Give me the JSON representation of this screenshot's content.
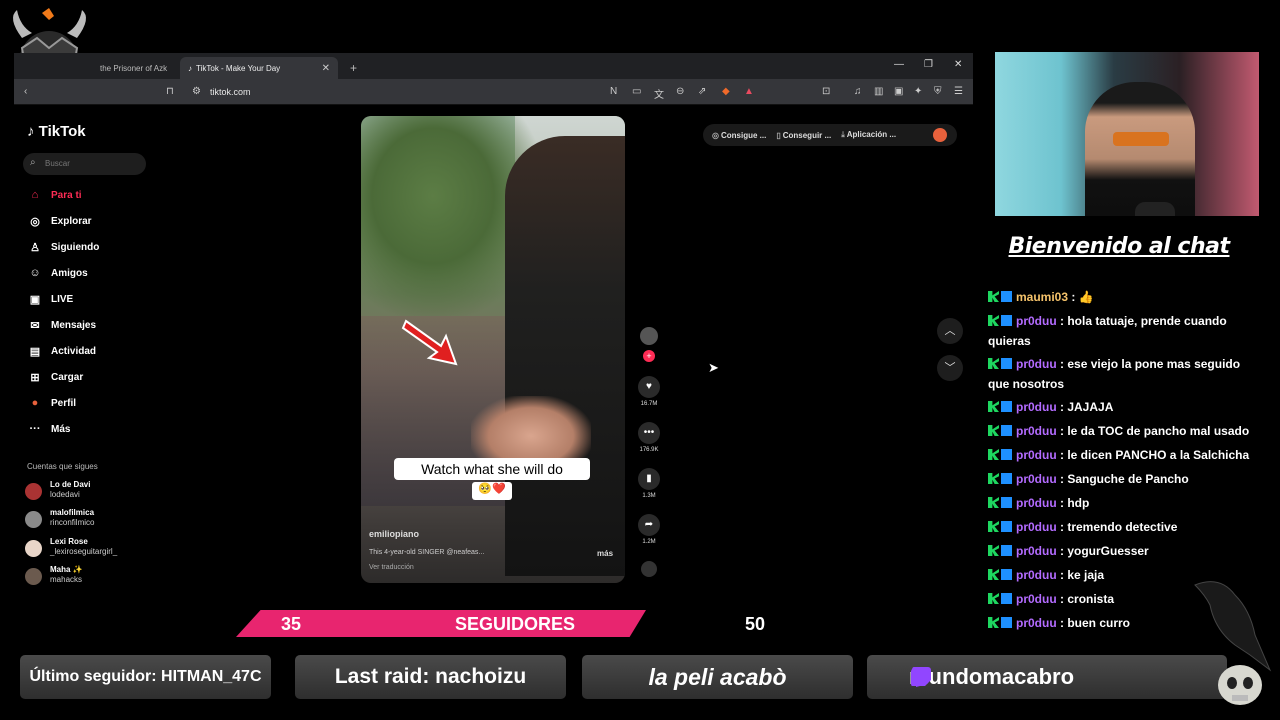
{
  "browser": {
    "tabs": [
      {
        "label": "the Prisoner of Azk"
      },
      {
        "label": "TikTok - Make Your Day"
      }
    ],
    "url": "tiktok.com"
  },
  "tiktok": {
    "logo": "TikTok",
    "search_placeholder": "Buscar",
    "nav": [
      {
        "label": "Para ti",
        "icon": "home-icon"
      },
      {
        "label": "Explorar",
        "icon": "compass-icon"
      },
      {
        "label": "Siguiendo",
        "icon": "following-icon"
      },
      {
        "label": "Amigos",
        "icon": "friends-icon"
      },
      {
        "label": "LIVE",
        "icon": "live-icon"
      },
      {
        "label": "Mensajes",
        "icon": "messages-icon"
      },
      {
        "label": "Actividad",
        "icon": "activity-icon"
      },
      {
        "label": "Cargar",
        "icon": "upload-icon"
      },
      {
        "label": "Perfil",
        "icon": "profile-icon"
      },
      {
        "label": "Más",
        "icon": "more-icon"
      }
    ],
    "following_title": "Cuentas que sigues",
    "accounts": [
      {
        "name": "Lo de Davi",
        "handle": "lodedavi"
      },
      {
        "name": "malofilmica",
        "handle": "rinconfilmico"
      },
      {
        "name": "Lexi Rose",
        "handle": "_lexiroseguitargirl_"
      },
      {
        "name": "Maha ✨",
        "handle": "mahacks"
      }
    ],
    "toplinks": [
      "Consigue ...",
      "Conseguir ...",
      "Aplicación ..."
    ],
    "video": {
      "caption": "Watch what she will do",
      "caption_emoji": "🥺❤️",
      "username": "emiliopiano",
      "description": "This 4-year-old SINGER @neafeas...",
      "more": "más",
      "translate": "Ver traducción"
    },
    "actions": [
      {
        "icon": "heart-icon",
        "count": "16.7M"
      },
      {
        "icon": "comment-icon",
        "count": "176.9K"
      },
      {
        "icon": "bookmark-icon",
        "count": "1.3M"
      },
      {
        "icon": "share-icon",
        "count": "1.2M"
      }
    ]
  },
  "chat": {
    "title": "Bienvenido al chat",
    "messages": [
      {
        "user": "maumi03",
        "text": " 👍"
      },
      {
        "user": "pr0duu",
        "text": "hola tatuaje, prende cuando quieras"
      },
      {
        "user": "pr0duu",
        "text": "ese viejo la pone mas seguido que nosotros"
      },
      {
        "user": "pr0duu",
        "text": "JAJAJA"
      },
      {
        "user": "pr0duu",
        "text": "le da TOC de pancho mal usado"
      },
      {
        "user": "pr0duu",
        "text": "le dicen PANCHO a la Salchicha"
      },
      {
        "user": "pr0duu",
        "text": "Sanguche de Pancho"
      },
      {
        "user": "pr0duu",
        "text": "hdp"
      },
      {
        "user": "pr0duu",
        "text": "tremendo detective"
      },
      {
        "user": "pr0duu",
        "text": "yogurGuesser"
      },
      {
        "user": "pr0duu",
        "text": "ke jaja"
      },
      {
        "user": "pr0duu",
        "text": "cronista"
      },
      {
        "user": "pr0duu",
        "text": "buen curro"
      }
    ]
  },
  "overlay": {
    "followers_current": "35",
    "followers_label": "SEGUIDORES",
    "followers_goal": "50",
    "followers_progress": 0.7,
    "last_follower": "Último seguidor: HITMAN_47C",
    "last_raid": "Last raid: nachoizu",
    "ticker": "la peli acabò",
    "channel": "mundomacabro"
  },
  "colors": {
    "tiktok_accent": "#fe2c55",
    "follow_bar": "#e8256f",
    "chat_user": "#b36bff",
    "twitch": "#9146ff"
  }
}
